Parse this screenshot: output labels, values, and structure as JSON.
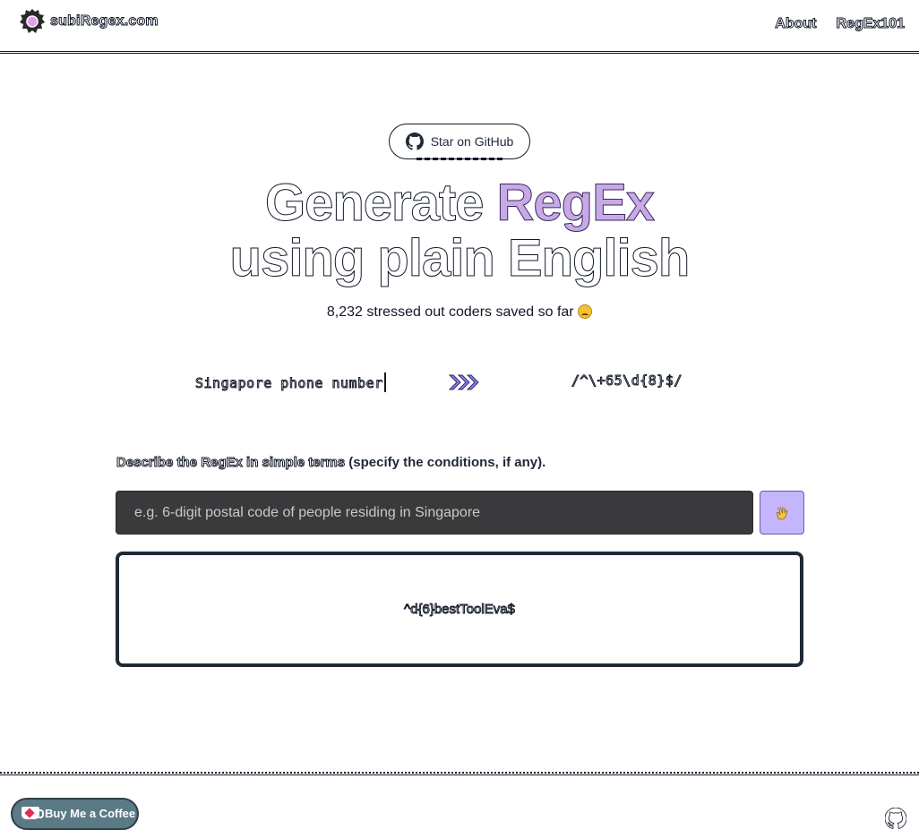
{
  "header": {
    "logo_text": "subiRegex.com",
    "nav": [
      {
        "label": "About"
      },
      {
        "label": "RegEx101"
      }
    ]
  },
  "star_button": {
    "label": "Star on GitHub",
    "icon": "github-icon"
  },
  "hero": {
    "line1_prefix": "Generate ",
    "line1_accent": "RegEx",
    "line2": "using plain English"
  },
  "counter": {
    "text": "8,232 stressed out coders saved so far",
    "emoji": "angry-face"
  },
  "demo": {
    "input_text": "Singapore phone number",
    "output_text": "/^\\+65\\d{8}$/",
    "arrow_icon": "chevrons-right-icon"
  },
  "prompt": {
    "label": "Describe the RegEx in simple terms",
    "hint": "(specify the conditions, if any).",
    "placeholder": "e.g. 6-digit postal code of people residing in Singapore",
    "value": ""
  },
  "submit": {
    "icon": "clap-icon"
  },
  "output": {
    "text": "^d{6}bestToolEva$"
  },
  "footer": {
    "coffee_label": "Buy Me a Coffee",
    "github_icon": "github-icon"
  },
  "colors": {
    "accent": "#c7a9e8",
    "input_bg": "#3a3a3c",
    "submit_bg": "#c4b5fd",
    "coffee_bg": "#5b7a86"
  }
}
